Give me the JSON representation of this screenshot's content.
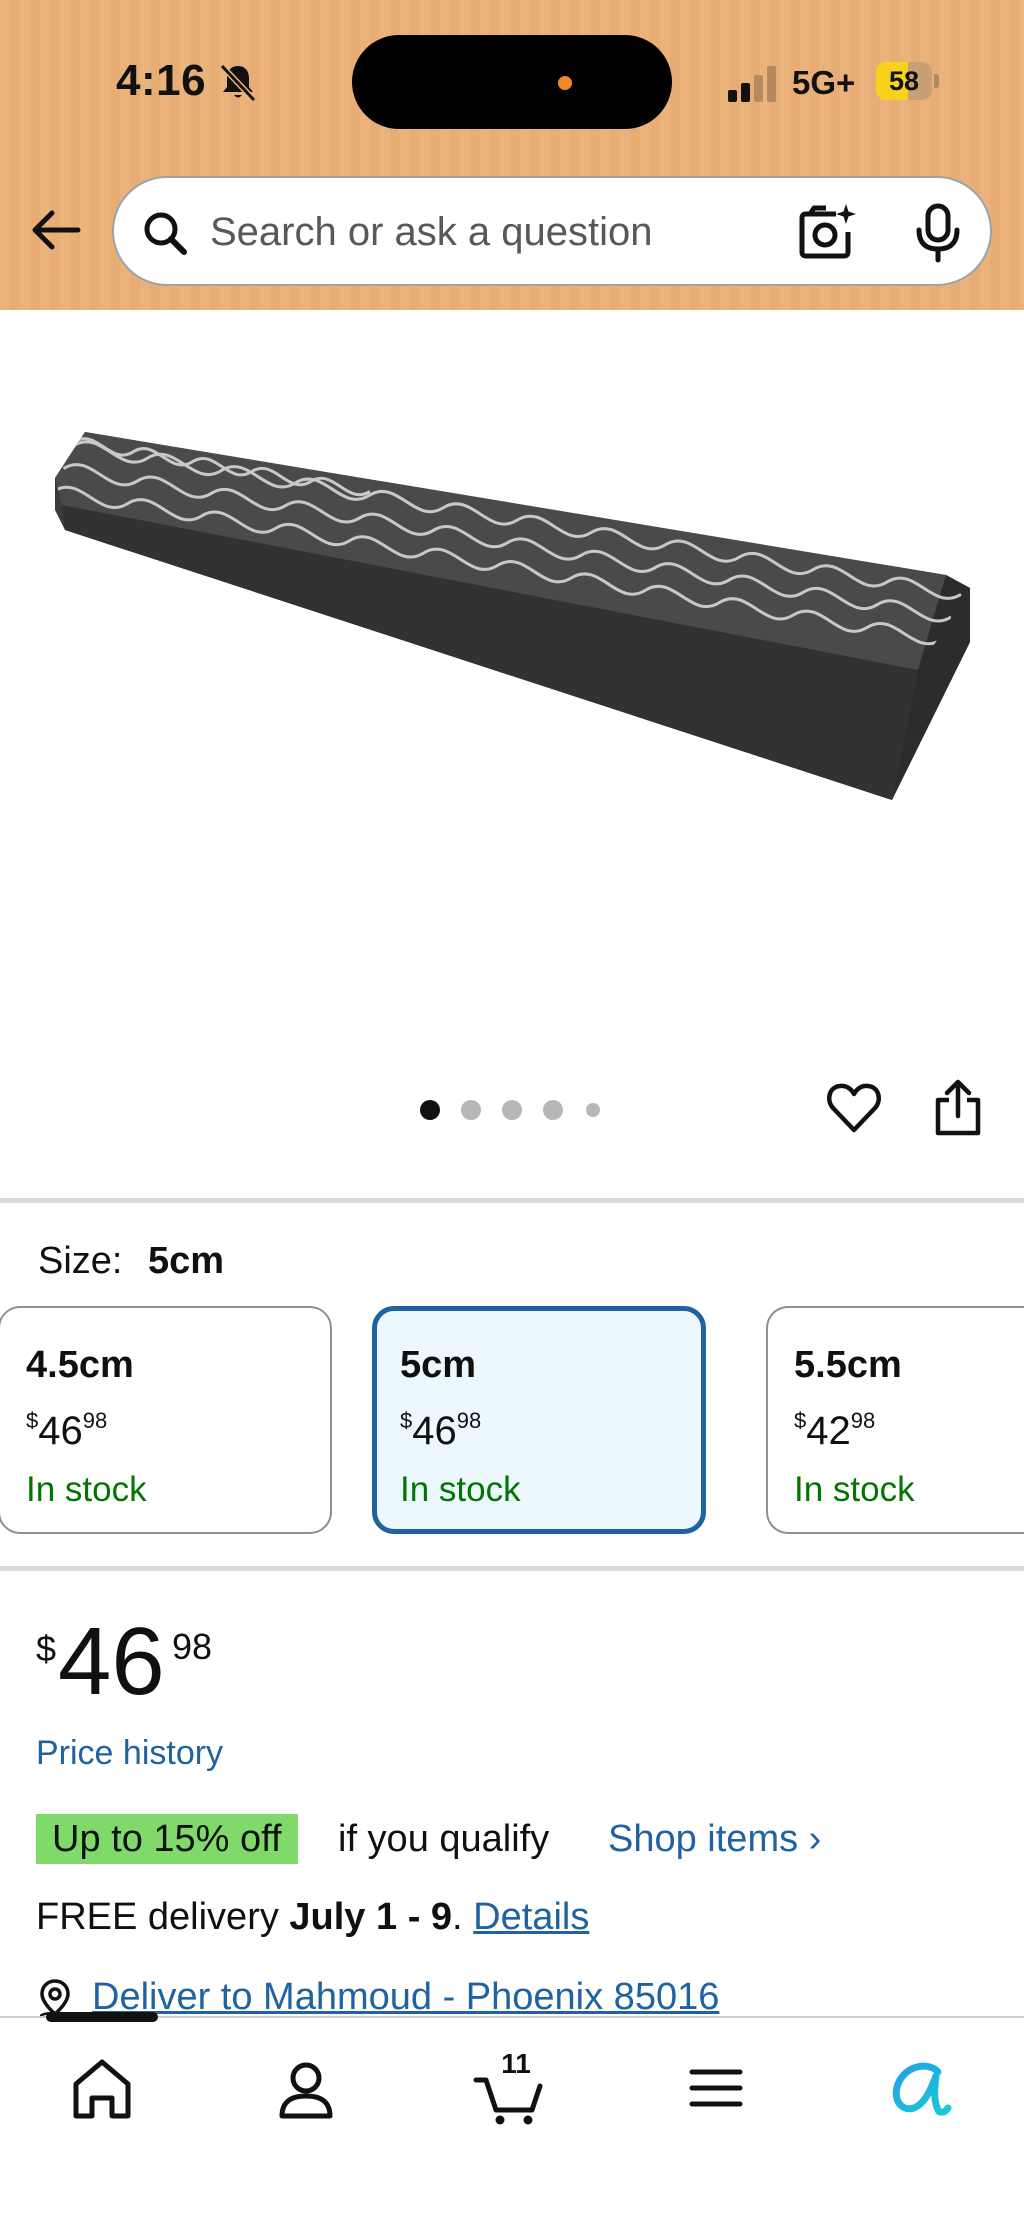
{
  "status_bar": {
    "time": "4:16",
    "network": "5G+",
    "battery_level": "58",
    "battery_fraction": 0.58,
    "icons": [
      "bell-muted-icon",
      "signal-icon",
      "battery-icon"
    ]
  },
  "search": {
    "placeholder": "Search or ask a question",
    "value": "",
    "icons": [
      "back-arrow-icon",
      "search-icon",
      "camera-search-icon",
      "microphone-icon"
    ]
  },
  "gallery": {
    "image_count": 5,
    "active_index": 0,
    "icons": [
      "heart-icon",
      "share-icon"
    ]
  },
  "size": {
    "label": "Size:",
    "selected": "5cm",
    "options": [
      {
        "name": "4.5cm",
        "currency": "$",
        "whole": "46",
        "fraction": "98",
        "stock": "In stock"
      },
      {
        "name": "5cm",
        "currency": "$",
        "whole": "46",
        "fraction": "98",
        "stock": "In stock"
      },
      {
        "name": "5.5cm",
        "currency": "$",
        "whole": "42",
        "fraction": "98",
        "stock": "In stock"
      }
    ]
  },
  "price": {
    "currency": "$",
    "whole": "46",
    "fraction": "98",
    "history_label": "Price history"
  },
  "promo": {
    "badge": "Up to 15% off",
    "text": "if you qualify",
    "link": "Shop items ›"
  },
  "delivery": {
    "prefix": "FREE delivery ",
    "dates": "July 1 - 9",
    "separator": ". ",
    "details_link": "Details"
  },
  "location": {
    "text": "Deliver to Mahmoud - Phoenix 85016"
  },
  "bottom_nav": {
    "cart_count": "11",
    "items": [
      "home-icon",
      "account-icon",
      "cart-icon",
      "menu-icon",
      "rufus-ai-icon"
    ]
  },
  "colors": {
    "header_bg": "#ebb37c",
    "link": "#2162a1",
    "in_stock": "#007600",
    "selected_border": "#2162a1",
    "selected_bg": "#edf8fe",
    "promo_badge": "#7fda69",
    "battery": "#f7d21a"
  }
}
